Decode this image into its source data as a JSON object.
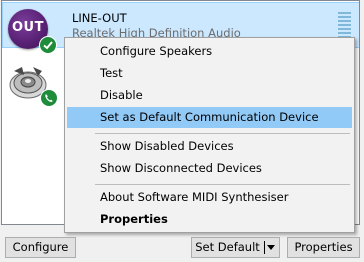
{
  "devices": [
    {
      "name": "LINE-OUT",
      "description": "Realtek High Definition Audio",
      "icon_label": "OUT",
      "icon": "line-out-icon",
      "status_badge": "default-check-icon",
      "selected": true
    },
    {
      "name": "",
      "description": "",
      "icon": "speaker-icon",
      "status_badge": "communication-phone-icon",
      "selected": false
    }
  ],
  "context_menu": {
    "items": [
      {
        "label": "Configure Speakers"
      },
      {
        "label": "Test"
      },
      {
        "label": "Disable"
      },
      {
        "label": "Set as Default Communication Device",
        "highlighted": true
      },
      {
        "label": "Show Disabled Devices"
      },
      {
        "label": "Show Disconnected Devices"
      },
      {
        "label": "About Software MIDI Synthesiser"
      },
      {
        "label": "Properties",
        "bold": true
      }
    ]
  },
  "buttons": {
    "configure": "Configure",
    "set_default": "Set Default",
    "properties": "Properties"
  },
  "colors": {
    "selection_bg": "#cce8ff",
    "menu_highlight": "#91c9f7",
    "badge_green": "#1e8c3a",
    "out_icon_purple": "#5a2276"
  }
}
